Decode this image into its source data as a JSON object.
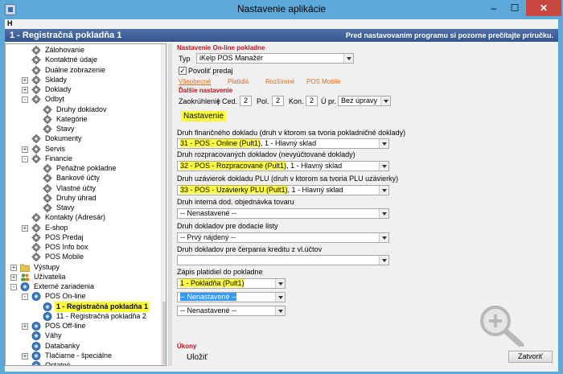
{
  "window": {
    "title": "Nastavenie aplikácie",
    "min": "–",
    "max": "☐",
    "close": "✕"
  },
  "menu": {
    "h": "H"
  },
  "header": {
    "title": "1 - Registračná pokladňa 1",
    "note": "Pred nastavovaním programu si pozorne prečítajte príručku."
  },
  "tree": [
    {
      "label": "Zálohovanie",
      "indent": 2,
      "icon": "gear-icon"
    },
    {
      "label": "Kontaktné údaje",
      "indent": 2,
      "icon": "gear-icon"
    },
    {
      "label": "Duálne zobrazenie",
      "indent": 2,
      "icon": "gear-icon"
    },
    {
      "label": "Sklady",
      "indent": 2,
      "icon": "gear-icon",
      "exp": "+"
    },
    {
      "label": "Doklady",
      "indent": 2,
      "icon": "gear-icon",
      "exp": "+"
    },
    {
      "label": "Odbyt",
      "indent": 2,
      "icon": "gear-icon",
      "exp": "-"
    },
    {
      "label": "Druhy dokladov",
      "indent": 3,
      "icon": "gear-icon"
    },
    {
      "label": "Kategórie",
      "indent": 3,
      "icon": "gear-icon"
    },
    {
      "label": "Stavy",
      "indent": 3,
      "icon": "gear-icon"
    },
    {
      "label": "Dokumenty",
      "indent": 2,
      "icon": "gear-icon"
    },
    {
      "label": "Servis",
      "indent": 2,
      "icon": "gear-icon",
      "exp": "+"
    },
    {
      "label": "Financie",
      "indent": 2,
      "icon": "gear-icon",
      "exp": "-"
    },
    {
      "label": "Peňažné pokladne",
      "indent": 3,
      "icon": "gear-icon"
    },
    {
      "label": "Bankové účty",
      "indent": 3,
      "icon": "gear-icon"
    },
    {
      "label": "Vlastné účty",
      "indent": 3,
      "icon": "gear-icon"
    },
    {
      "label": "Druhy úhrad",
      "indent": 3,
      "icon": "gear-icon"
    },
    {
      "label": "Stavy",
      "indent": 3,
      "icon": "gear-icon"
    },
    {
      "label": "Kontakty (Adresár)",
      "indent": 2,
      "icon": "gear-icon"
    },
    {
      "label": "E-shop",
      "indent": 2,
      "icon": "gear-icon",
      "exp": "+"
    },
    {
      "label": "POS Predaj",
      "indent": 2,
      "icon": "gear-icon"
    },
    {
      "label": "POS Info box",
      "indent": 2,
      "icon": "gear-icon"
    },
    {
      "label": "POS Mobile",
      "indent": 2,
      "icon": "gear-icon"
    },
    {
      "label": "Výstupy",
      "indent": 1,
      "icon": "folder-icon",
      "exp": "+"
    },
    {
      "label": "Užívatelia",
      "indent": 1,
      "icon": "users-icon",
      "exp": "+"
    },
    {
      "label": "Externé zariadenia",
      "indent": 1,
      "icon": "device-icon",
      "exp": "-"
    },
    {
      "label": "POS On-line",
      "indent": 2,
      "icon": "device-icon",
      "exp": "-"
    },
    {
      "label": "1 - Registračná pokladňa 1",
      "indent": 3,
      "icon": "device-icon",
      "selected": true
    },
    {
      "label": "11 - Registračná pokladňa 2",
      "indent": 3,
      "icon": "device-icon"
    },
    {
      "label": "POS Off-line",
      "indent": 2,
      "icon": "device-icon",
      "exp": "+"
    },
    {
      "label": "Váhy",
      "indent": 2,
      "icon": "device-icon"
    },
    {
      "label": "Databanky",
      "indent": 2,
      "icon": "device-icon"
    },
    {
      "label": "Tlačiarne - špeciálne",
      "indent": 2,
      "icon": "device-icon",
      "exp": "+"
    },
    {
      "label": "Ostatné",
      "indent": 2,
      "icon": "device-icon"
    }
  ],
  "pane": {
    "section_online": "Nastavenie On-line pokladne",
    "typ_label": "Typ",
    "typ_value": "iKelp POS Manažér",
    "povolit_label": "Povoliť predaj",
    "tabs": [
      "Všeobecné",
      "Platidlá",
      "Rozšírené",
      "POS Mobile"
    ],
    "section_dalsie": "Ďalšie nastavenie",
    "zaokruhlenie_label": "Zaokrúhlenie",
    "sep": "|",
    "ced_label": "Ced.",
    "ced_value": "2",
    "pol_label": "Pol.",
    "pol_value": "2",
    "kon_label": "Kon.",
    "kon_value": "2",
    "upr_label": "Ú pr.",
    "upr_value": "Bez úpravy",
    "nastavenie_btn": "Nastavenie",
    "f1_label": "Druh finančného dokladu (druh v ktorom sa tvoria pokladničné doklady)",
    "f1_hl": "31 - POS - Online (Pult1)",
    "f1_rest": ", 1 - Hlavný sklad",
    "f2_label": "Druh rozpracovaných dokladov (nevyúčtované doklady)",
    "f2_hl": "32 - POS - Rozpracované (Pult1)",
    "f2_rest": ", 1 - Hlavný sklad",
    "f3_label": "Druh uzávierok dokladu PLU (druh v ktorom sa tvoria PLU uzávierky)",
    "f3_hl": "33 - POS - Uzávierky PLU (Pult1)",
    "f3_rest": ", 1 - Hlavný sklad",
    "f4_label": "Druh interná dod. objednávka tovaru",
    "f4_value": "-- Nenastavené --",
    "f5_label": "Druh dokladov pre dodacie listy",
    "f5_value": "-- Prvý nájdený --",
    "f6_label": "Druh dokladov pre čerpania kreditu z vl.účtov",
    "f6_value": "",
    "zapis_label": "Zápis platidiel do pokladne",
    "z1": "1 - Pokladňa (Pult1)",
    "z2": "-- Nenastavené --",
    "z3": "-- Nenastavené --",
    "ukony": "Úkony",
    "ulozit": "Uložiť",
    "zatvorit": "Zatvoriť"
  },
  "colors": {
    "accent": "#c0141e",
    "highlight": "#ffff3a",
    "tab": "#e06b1e"
  }
}
